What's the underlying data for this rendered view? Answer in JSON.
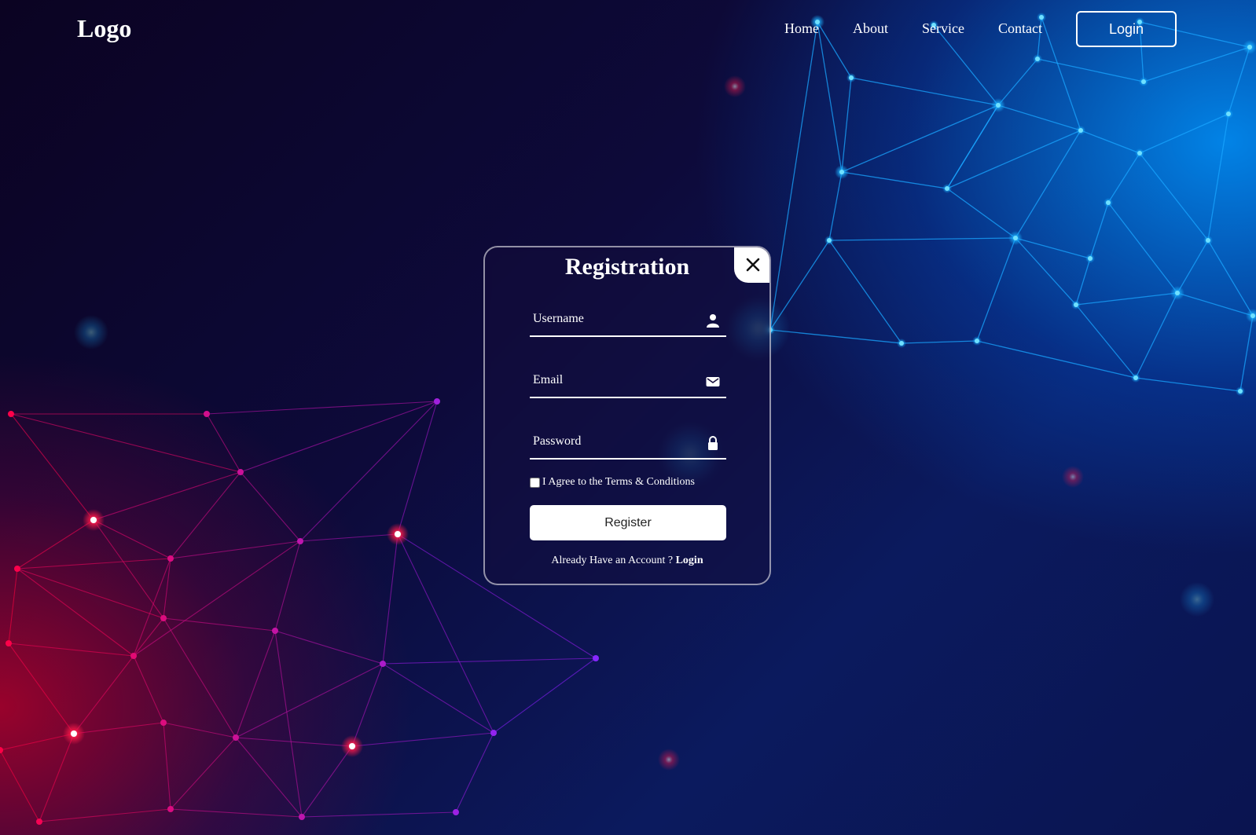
{
  "header": {
    "logo": "Logo",
    "nav": [
      "Home",
      "About",
      "Service",
      "Contact"
    ],
    "login_label": "Login"
  },
  "modal": {
    "title": "Registration",
    "username_placeholder": "Username",
    "email_placeholder": "Email",
    "password_placeholder": "Password",
    "agree_text": "I Agree to the Terms & Conditions",
    "register_label": "Register",
    "already_text": "Already Have an Account ?",
    "login_link": "Login"
  },
  "colors": {
    "accent_blue": "#00a8ff",
    "accent_red": "#ff1a4a",
    "accent_purple": "#7a2cff"
  }
}
